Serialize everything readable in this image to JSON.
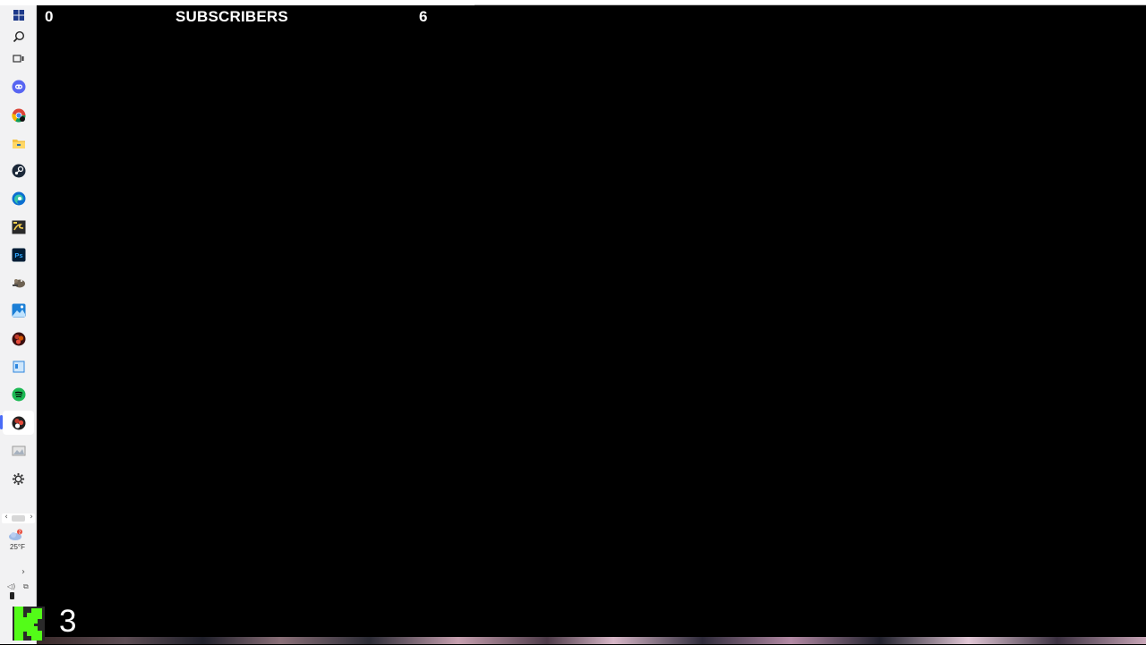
{
  "overlay": {
    "left_count": "0",
    "title": "SUBSCRIBERS",
    "right_count": "6",
    "kick_count": "3"
  },
  "taskbar": {
    "icons": [
      {
        "name": "start-icon"
      },
      {
        "name": "search-icon"
      },
      {
        "name": "task-view-icon"
      },
      {
        "name": "discord-icon"
      },
      {
        "name": "chrome-icon"
      },
      {
        "name": "file-explorer-icon"
      },
      {
        "name": "steam-icon"
      },
      {
        "name": "edge-icon"
      },
      {
        "name": "app-icon"
      },
      {
        "name": "photoshop-icon"
      },
      {
        "name": "gimp-icon"
      },
      {
        "name": "photos-icon"
      },
      {
        "name": "obs-icon"
      },
      {
        "name": "app-window-icon"
      },
      {
        "name": "spotify-icon"
      },
      {
        "name": "obs-studio-icon"
      },
      {
        "name": "image-viewer-icon"
      },
      {
        "name": "settings-icon"
      }
    ],
    "scroll_left": "‹",
    "scroll_right": "›",
    "weather_temp": "25°F",
    "weather_badge": "2",
    "tray_chevron": "›",
    "tray_volume": "◁)",
    "tray_network": "⧉"
  },
  "colors": {
    "background": "#000000",
    "taskbar_bg": "#f2f2f3",
    "overlay_text": "#ffffff",
    "kick_green": "#53fc18"
  }
}
